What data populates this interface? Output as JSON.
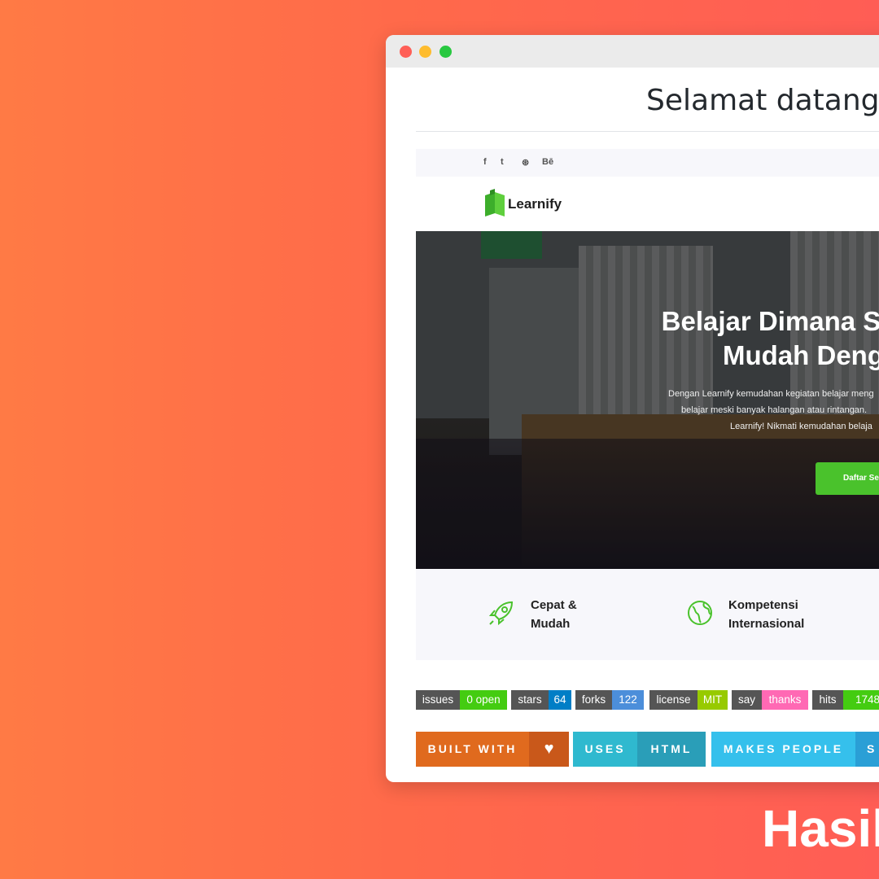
{
  "window": {
    "title_text": "Selamat datang"
  },
  "site": {
    "social": [
      "f",
      "t",
      "⊛",
      "Bē"
    ],
    "brand_name": "Learnify",
    "hero": {
      "title_line1": "Belajar Dimana S",
      "title_line2": "Mudah Deng",
      "desc_line1": "Dengan Learnify kemudahan kegiatan belajar meng",
      "desc_line2": "belajar meski banyak halangan atau rintangan.",
      "desc_line3": "Learnify! Nikmati kemudahan belaja",
      "button_label": "Daftar Se"
    },
    "features": [
      {
        "line1": "Cepat &",
        "line2": "Mudah",
        "icon": "rocket-icon"
      },
      {
        "line1": "Kompetensi",
        "line2": "Internasional",
        "icon": "globe-icon"
      }
    ]
  },
  "badges": [
    {
      "label": "issues",
      "value": "0 open",
      "color": "#4c1"
    },
    {
      "label": "stars",
      "value": "64",
      "color": "#007ec6"
    },
    {
      "label": "forks",
      "value": "122",
      "color": "#4c8eda"
    },
    {
      "label": "license",
      "value": "MIT",
      "color": "#97ca00"
    },
    {
      "label": "say",
      "value": "thanks",
      "color": "#ff69b4"
    },
    {
      "label": "hits",
      "value": "1748",
      "color": "#4c1"
    }
  ],
  "for_the_badge": [
    {
      "label": "BUILT WITH",
      "value": "♥",
      "left_color": "#e06a1e",
      "right_color": "#c9581a"
    },
    {
      "label": "USES",
      "value": "HTML",
      "left_color": "#2fb9cf",
      "right_color": "#2a9eb8"
    },
    {
      "label": "MAKES PEOPLE",
      "value": "S",
      "left_color": "#35c0ec",
      "right_color": "#2a9fd6"
    }
  ],
  "footer_text": "Hasil"
}
